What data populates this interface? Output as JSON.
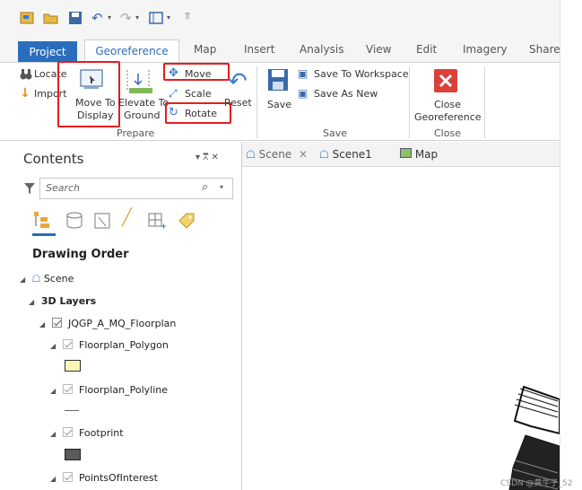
{
  "ribbon_tabs": [
    "Project",
    "Georeference",
    "Map",
    "Insert",
    "Analysis",
    "View",
    "Edit",
    "Imagery",
    "Share"
  ],
  "prepare": {
    "locate": "Locate",
    "import": "Import",
    "move_to_display": "Move To Display",
    "move_to_display_l1": "Move To",
    "move_to_display_l2": "Display",
    "elevate_l1": "Elevate To",
    "elevate_l2": "Ground",
    "move": "Move",
    "scale": "Scale",
    "rotate": "Rotate",
    "reset": "Reset",
    "group": "Prepare"
  },
  "save": {
    "save": "Save",
    "save_to_workspace": "Save To Workspace",
    "save_as_new": "Save As New",
    "group": "Save"
  },
  "close": {
    "close_l1": "Close",
    "close_l2": "Georeference",
    "group": "Close"
  },
  "contents": {
    "title": "Contents",
    "pin": "− ȩ ×",
    "search_placeholder": "Search",
    "drawing_order": "Drawing Order",
    "scene": "Scene",
    "layers_3d": "3D Layers",
    "group_layer": "JQGP_A_MQ_Floorplan",
    "sublayers": [
      "Floorplan_Polygon",
      "Floorplan_Polyline",
      "Footprint",
      "PointsOfInterest"
    ]
  },
  "view_tabs": [
    "Scene",
    "Scene1",
    "Map"
  ],
  "watermark": "CSDN @黄牛子_52",
  "colors": {
    "accent": "#2a6ebb",
    "highlight_box": "#e81c1c",
    "polygon_swatch": "#fdf6b8",
    "footprint_swatch": "#5a5a5a"
  }
}
